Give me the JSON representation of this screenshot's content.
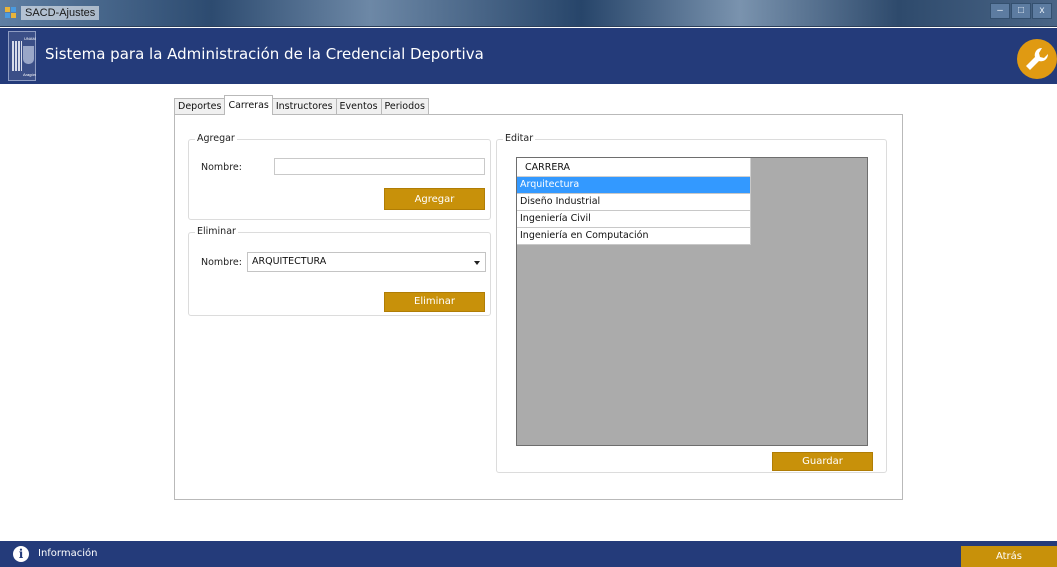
{
  "window": {
    "title": "SACD-Ajustes",
    "minimize": "–",
    "maximize": "□",
    "close": "x"
  },
  "header": {
    "title": "Sistema para la Administración de la Credencial Deportiva",
    "logo_top": "UNAM",
    "logo_bottom": "Aragón",
    "settings_icon": "wrench-icon"
  },
  "tabs": [
    "Deportes",
    "Carreras",
    "Instructores",
    "Eventos",
    "Periodos"
  ],
  "active_tab": "Carreras",
  "agregar": {
    "group_label": "Agregar",
    "nombre_label": "Nombre:",
    "nombre_value": "",
    "button": "Agregar"
  },
  "eliminar": {
    "group_label": "Eliminar",
    "nombre_label": "Nombre:",
    "selected": "ARQUITECTURA",
    "button": "Eliminar"
  },
  "editar": {
    "group_label": "Editar",
    "column_header": "CARRERA",
    "rows": [
      "Arquitectura",
      "Diseño Industrial",
      "Ingeniería Civil",
      "Ingeniería en Computación"
    ],
    "selected_row": 0,
    "button": "Guardar"
  },
  "footer": {
    "info_label": "Información",
    "back_button": "Atrás"
  },
  "colors": {
    "header_bg": "#243b7a",
    "accent": "#c8910a",
    "selection": "#3399ff"
  }
}
